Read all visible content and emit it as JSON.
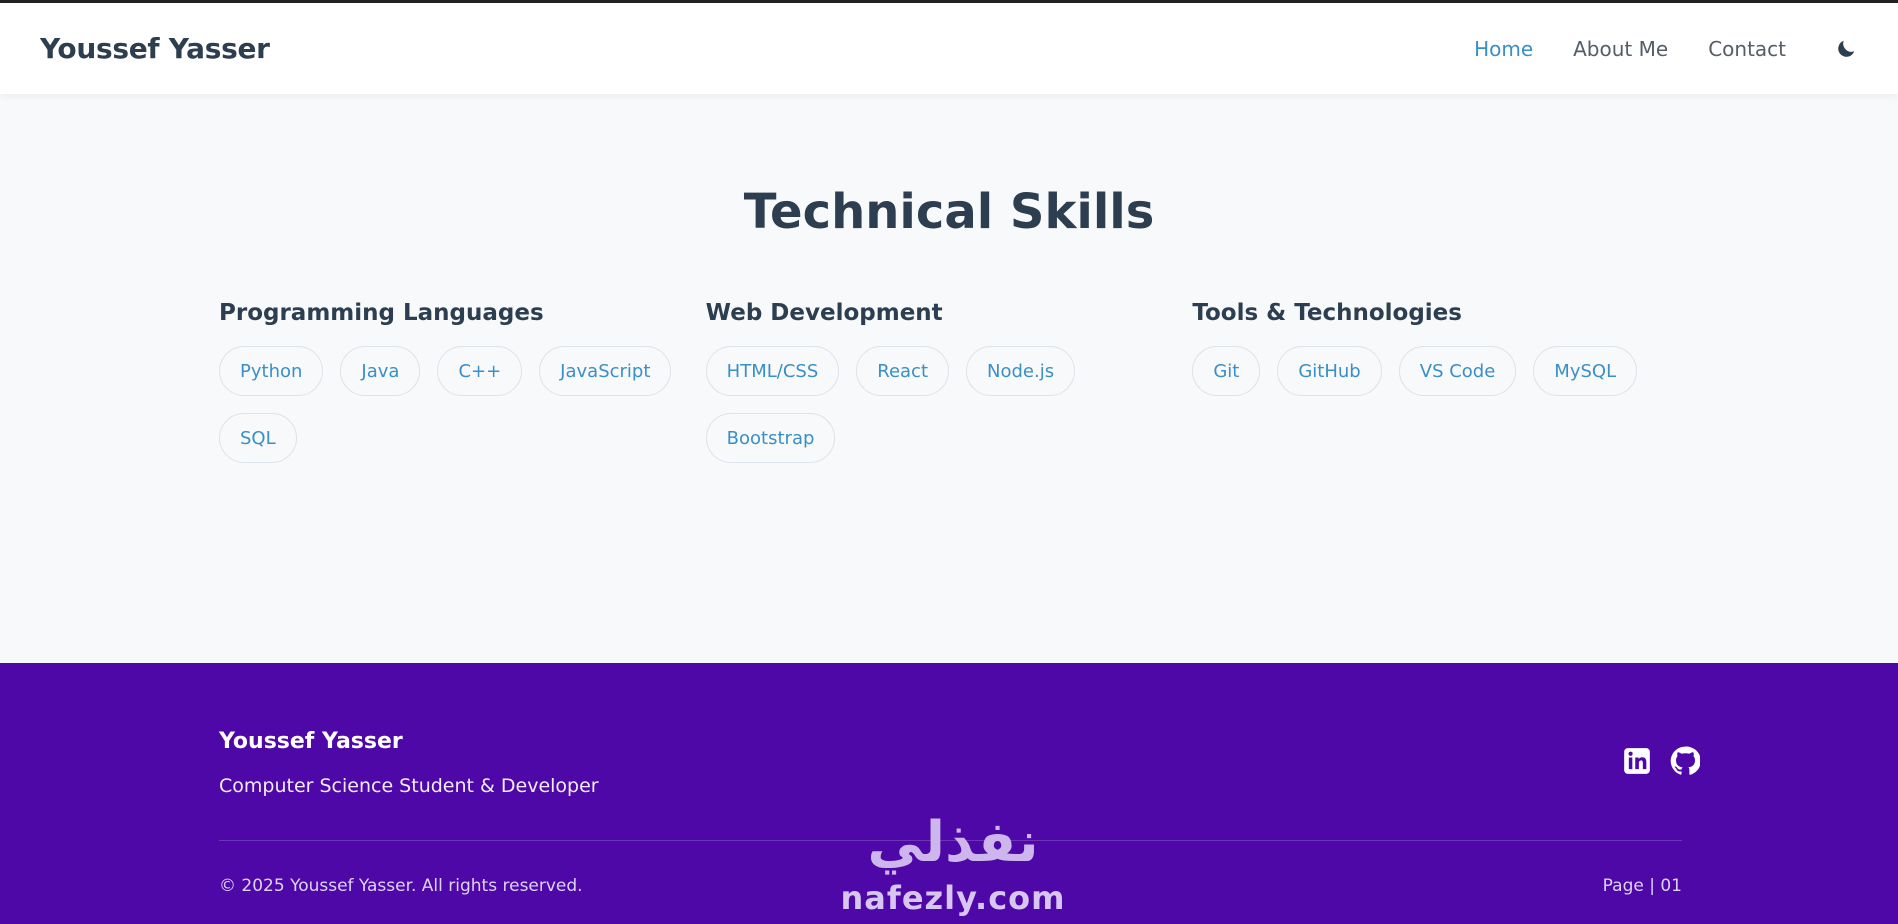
{
  "navbar": {
    "brand": "Youssef Yasser",
    "links": [
      {
        "label": "Home"
      },
      {
        "label": "About Me"
      },
      {
        "label": "Contact"
      }
    ],
    "theme_icon": "moon-icon"
  },
  "skills": {
    "title": "Technical Skills",
    "categories": [
      {
        "title": "Programming Languages",
        "items": [
          "Python",
          "Java",
          "C++",
          "JavaScript",
          "SQL"
        ]
      },
      {
        "title": "Web Development",
        "items": [
          "HTML/CSS",
          "React",
          "Node.js",
          "Bootstrap"
        ]
      },
      {
        "title": "Tools & Technologies",
        "items": [
          "Git",
          "GitHub",
          "VS Code",
          "MySQL"
        ]
      }
    ]
  },
  "footer": {
    "name": "Youssef Yasser",
    "tagline": "Computer Science Student & Developer",
    "copyright": "© 2025 Youssef Yasser. All rights reserved.",
    "page": "Page | 01",
    "social_icons": [
      "linkedin-icon",
      "github-icon"
    ]
  },
  "watermark": {
    "arabic": "نفذلي",
    "latin": "nafezly.com"
  },
  "colors": {
    "accent": "#3a8fc7",
    "heading": "#2c3e50",
    "footer_bg": "#4f08a8",
    "page_bg": "#f8f9fb"
  }
}
